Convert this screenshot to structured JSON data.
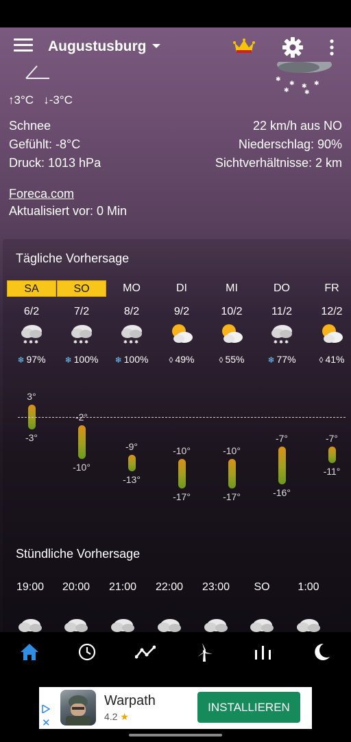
{
  "appbar": {
    "city": "Augustusburg"
  },
  "current": {
    "temp_max": "↑3°C",
    "temp_min": "↓-3°C",
    "condition": "Schnee",
    "feels_like": "Gefühlt: -8°C",
    "pressure": "Druck: 1013 hPa",
    "wind": "22 km/h aus NO",
    "precip": "Niederschlag: 90%",
    "visibility": "Sichtverhältnisse: 2 km",
    "source": "Foreca.com",
    "updated": "Aktualisiert vor: 0 Min"
  },
  "daily": {
    "title": "Tägliche Vorhersage",
    "days": [
      {
        "name": "SA",
        "date": "6/2",
        "icon": "snow-cloud-icon",
        "precip": "97%",
        "precip_type": "snow",
        "max": 3,
        "min": -3,
        "max_label": "3°",
        "min_label": "-3°",
        "highlight": true
      },
      {
        "name": "SO",
        "date": "7/2",
        "icon": "snow-cloud-icon",
        "precip": "100%",
        "precip_type": "snow",
        "max": -2,
        "min": -10,
        "max_label": "-2°",
        "min_label": "-10°",
        "highlight": true
      },
      {
        "name": "MO",
        "date": "8/2",
        "icon": "snow-cloud-icon",
        "precip": "100%",
        "precip_type": "snow",
        "max": -9,
        "min": -13,
        "max_label": "-9°",
        "min_label": "-13°",
        "highlight": false
      },
      {
        "name": "DI",
        "date": "9/2",
        "icon": "sun-cloud-icon",
        "precip": "49%",
        "precip_type": "rain",
        "max": -10,
        "min": -17,
        "max_label": "-10°",
        "min_label": "-17°",
        "highlight": false
      },
      {
        "name": "MI",
        "date": "10/2",
        "icon": "sun-cloud-icon",
        "precip": "55%",
        "precip_type": "rain",
        "max": -10,
        "min": -17,
        "max_label": "-10°",
        "min_label": "-17°",
        "highlight": false
      },
      {
        "name": "DO",
        "date": "11/2",
        "icon": "snow-cloud-icon",
        "precip": "77%",
        "precip_type": "snow",
        "max": -7,
        "min": -16,
        "max_label": "-7°",
        "min_label": "-16°",
        "highlight": false
      },
      {
        "name": "FR",
        "date": "12/2",
        "icon": "sun-cloud-icon",
        "precip": "41%",
        "precip_type": "rain",
        "max": -7,
        "min": -11,
        "max_label": "-7°",
        "min_label": "-11°",
        "highlight": false
      }
    ]
  },
  "hourly": {
    "title": "Stündliche Vorhersage",
    "hours": [
      "19:00",
      "20:00",
      "21:00",
      "22:00",
      "23:00",
      "SO",
      "1:00"
    ]
  },
  "nav": {
    "items": [
      "home-icon",
      "clock-icon",
      "trend-icon",
      "wind-turbine-icon",
      "bars-icon",
      "moon-icon"
    ],
    "active_color": "#2f8de4"
  },
  "ad": {
    "title": "Warpath",
    "rating": "4.2",
    "button": "INSTALLIEREN"
  },
  "colors": {
    "highlight": "#f8c51b",
    "ad_button": "#168a5a",
    "snow_icon": "#6ec6ff"
  }
}
